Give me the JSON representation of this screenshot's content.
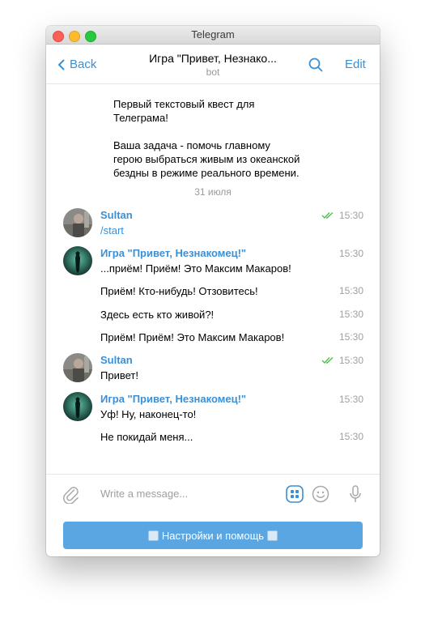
{
  "window": {
    "title": "Telegram"
  },
  "header": {
    "back_label": "Back",
    "chat_title": "Игра \"Привет, Незнако...",
    "chat_subtitle": "bot",
    "edit_label": "Edit"
  },
  "intro": {
    "line1": "Первый текстовый квест для",
    "line2": "Телеграма!",
    "line3": "Ваша задача - помочь главному",
    "line4": "герою выбраться живым из океанской",
    "line5": "бездны в режиме реального времени."
  },
  "date_separator": "31 июля",
  "messages": [
    {
      "sender": "Sultan",
      "text": "/start",
      "time": "15:30",
      "read": true
    },
    {
      "sender": "Игра \"Привет, Незнакомец!\"",
      "text": "...приём! Приём! Это Максим Макаров!",
      "time": "15:30"
    },
    {
      "text": "Приём! Кто-нибудь! Отзовитесь!",
      "time": "15:30"
    },
    {
      "text": "Здесь есть кто живой?!",
      "time": "15:30"
    },
    {
      "text": "Приём! Приём! Это Максим Макаров!",
      "time": "15:30"
    },
    {
      "sender": "Sultan",
      "text": "Привет!",
      "time": "15:30",
      "read": true
    },
    {
      "sender": "Игра \"Привет, Незнакомец!\"",
      "text": "Уф! Ну, наконец-то!",
      "time": "15:30"
    },
    {
      "text": "Не покидай меня...",
      "time": "15:30"
    }
  ],
  "composer": {
    "placeholder": "Write a message..."
  },
  "bot_keyboard": {
    "button_label": "Настройки и помощь"
  },
  "colors": {
    "accent": "#3b8fd5",
    "read_check": "#4cc04a",
    "keyboard_button": "#5aa6e2"
  }
}
